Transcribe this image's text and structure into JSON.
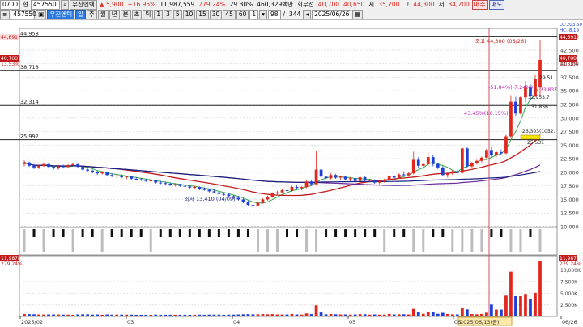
{
  "toolbar": {
    "screen_no": "0700",
    "mode": "현",
    "code": "457550",
    "name": "우진엔텍",
    "price_change": "▲ 5,900",
    "change_pct": "+16.95%",
    "volume": "11,987,559",
    "vol_ratio": "279.24%",
    "trade_share": "29.30%",
    "trade_amount": "460,329백만",
    "prev_label": "회우선",
    "price": "40,700",
    "open_val": "40,650",
    "open_label": "시",
    "open2": "35,700",
    "high_label": "고",
    "high_val": "44,300",
    "low_label": "저",
    "low_val": "34,200",
    "sell_btn": "매수",
    "buy_btn": "매도",
    "periods": [
      "주",
      "월",
      "년",
      "분",
      "초",
      "틱"
    ],
    "minutes": [
      "1",
      "3",
      "5",
      "10",
      "15",
      "30",
      "45",
      "60"
    ],
    "count_a": "1",
    "count_b": "98",
    "count_c": "344",
    "date": "2025/06/26"
  },
  "axis": {
    "price_ticks": [
      "45,000",
      "42,500",
      "40,000",
      "37,500",
      "35,000",
      "32,500",
      "30,000",
      "27,500",
      "25,000",
      "22,500",
      "20,000",
      "17,500",
      "15,000",
      "12,500",
      "10,000"
    ],
    "osc_ticks": [],
    "vol_ticks": [
      "10,000K",
      "7,500K",
      "5,000K",
      "2,500K"
    ],
    "x_labels": [
      "2025/02",
      "03",
      "04",
      "05",
      "06",
      "06/26"
    ],
    "cursor_date": "2025/06/13(금)"
  },
  "labels": {
    "left_top": "44,691",
    "left_price": "40,700",
    "left_pct": "13.53%",
    "right_high": "44,691",
    "right_price": "40,700",
    "right_pct": "13.53%",
    "right_vol": "11,987K",
    "right_vol_pct": "279.24%",
    "lc": "LC:203.50",
    "hc": "HC:-8.19",
    "left_vol": "11,987K",
    "left_vol_pct": "279.24%"
  },
  "levels": [
    {
      "value": 44958,
      "label": "44,958"
    },
    {
      "value": 38718,
      "label": "38,718"
    },
    {
      "value": 32314,
      "label": "32,314"
    },
    {
      "value": 25992,
      "label": "25,992"
    }
  ],
  "annotations": {
    "high": "최고 44,300 (06/26)",
    "low": "최저 13,410 (04/09)",
    "fib1": "-51.84%(-7.24%)",
    "fib2": "43.45%(16.15%)",
    "v1": "33,837",
    "v2": "31,856",
    "v3": "32,953.7",
    "v4": "26,303(1052.",
    "v5": "25,531",
    "v6": "29.51"
  },
  "colors": {
    "up": "#e0261d",
    "down": "#1f3fd6",
    "ma5": "#2fa84f",
    "ma20": "#c21b1b",
    "ma60": "#6a2a9a",
    "ma120": "#1a237e",
    "cursor": "#d63a5a"
  },
  "chart_data": {
    "type": "candlestick",
    "ylim": [
      10000,
      46500
    ],
    "x_start": "2025/02",
    "candles": [
      [
        21500,
        22200,
        21100,
        21800
      ],
      [
        21800,
        22000,
        21000,
        21200
      ],
      [
        21200,
        21500,
        20600,
        20900
      ],
      [
        20900,
        21400,
        20600,
        21200
      ],
      [
        21200,
        21800,
        21000,
        21500
      ],
      [
        21500,
        21600,
        20800,
        21000
      ],
      [
        21000,
        21300,
        20500,
        20700
      ],
      [
        20700,
        21300,
        20500,
        21100
      ],
      [
        21100,
        21400,
        20700,
        21000
      ],
      [
        21000,
        21500,
        20800,
        21300
      ],
      [
        21300,
        21700,
        21100,
        21500
      ],
      [
        21500,
        21600,
        20800,
        21000
      ],
      [
        21000,
        21200,
        20300,
        20500
      ],
      [
        20500,
        20900,
        20000,
        20300
      ],
      [
        20300,
        20500,
        19800,
        20000
      ],
      [
        20000,
        20300,
        19500,
        19800
      ],
      [
        19800,
        20200,
        19600,
        20000
      ],
      [
        20000,
        20100,
        19300,
        19500
      ],
      [
        19500,
        19800,
        19100,
        19300
      ],
      [
        19300,
        19700,
        19000,
        19400
      ],
      [
        19400,
        19600,
        18900,
        19100
      ],
      [
        19100,
        19400,
        18700,
        19200
      ],
      [
        19200,
        19300,
        18600,
        18800
      ],
      [
        18800,
        19100,
        18500,
        18700
      ],
      [
        18700,
        19000,
        18400,
        18600
      ],
      [
        18600,
        18800,
        18200,
        18400
      ],
      [
        18400,
        18700,
        18100,
        18500
      ],
      [
        18500,
        18600,
        17900,
        18100
      ],
      [
        18100,
        18400,
        17800,
        18000
      ],
      [
        18000,
        18300,
        17700,
        17900
      ],
      [
        17900,
        18100,
        17500,
        17700
      ],
      [
        17700,
        18000,
        17400,
        17800
      ],
      [
        17800,
        17900,
        17300,
        17500
      ],
      [
        17500,
        17800,
        17200,
        17400
      ],
      [
        17400,
        17600,
        17000,
        17200
      ],
      [
        17200,
        17500,
        16900,
        17300
      ],
      [
        17300,
        17400,
        16700,
        16900
      ],
      [
        16900,
        17200,
        16600,
        16800
      ],
      [
        16800,
        17000,
        16300,
        16500
      ],
      [
        16500,
        16800,
        16100,
        16300
      ],
      [
        16300,
        16500,
        15800,
        16000
      ],
      [
        16000,
        16300,
        15700,
        15900
      ],
      [
        15900,
        16100,
        15400,
        15600
      ],
      [
        15600,
        15800,
        15100,
        15300
      ],
      [
        15300,
        15600,
        14800,
        15000
      ],
      [
        15000,
        15200,
        14300,
        14500
      ],
      [
        14500,
        14800,
        13800,
        14000
      ],
      [
        14000,
        14300,
        13410,
        13900
      ],
      [
        13900,
        14600,
        13700,
        14400
      ],
      [
        14400,
        15200,
        14200,
        15000
      ],
      [
        15000,
        15700,
        14800,
        15500
      ],
      [
        15500,
        16300,
        15300,
        16100
      ],
      [
        16100,
        16600,
        15800,
        16300
      ],
      [
        16300,
        16900,
        16100,
        16700
      ],
      [
        16700,
        17200,
        16400,
        16600
      ],
      [
        16600,
        17500,
        16400,
        17300
      ],
      [
        17300,
        17700,
        16900,
        17100
      ],
      [
        17100,
        17400,
        16700,
        17300
      ],
      [
        17300,
        18500,
        17100,
        18300
      ],
      [
        18300,
        18600,
        17600,
        17800
      ],
      [
        17800,
        24000,
        17600,
        20500
      ],
      [
        20500,
        20800,
        18800,
        19200
      ],
      [
        19200,
        19500,
        18600,
        18900
      ],
      [
        18900,
        19800,
        18700,
        19500
      ],
      [
        19500,
        19700,
        18800,
        19000
      ],
      [
        19000,
        19400,
        18600,
        19200
      ],
      [
        19200,
        19300,
        18500,
        18700
      ],
      [
        18700,
        19100,
        18400,
        18900
      ],
      [
        18900,
        19000,
        18200,
        18400
      ],
      [
        18400,
        19300,
        18300,
        19100
      ],
      [
        19100,
        19200,
        18300,
        18500
      ],
      [
        18500,
        18800,
        18100,
        18600
      ],
      [
        18600,
        18700,
        17900,
        18100
      ],
      [
        18100,
        18500,
        17800,
        18300
      ],
      [
        18300,
        18800,
        18100,
        18600
      ],
      [
        18600,
        19500,
        18400,
        19300
      ],
      [
        19300,
        19600,
        18800,
        19000
      ],
      [
        19000,
        19800,
        18900,
        19600
      ],
      [
        19600,
        20200,
        19300,
        19500
      ],
      [
        19500,
        20000,
        19200,
        19800
      ],
      [
        19800,
        23800,
        19600,
        22300
      ],
      [
        22300,
        22800,
        20700,
        21200
      ],
      [
        21200,
        21700,
        20500,
        21500
      ],
      [
        21500,
        23700,
        21200,
        22800
      ],
      [
        22800,
        23200,
        21100,
        21500
      ],
      [
        21500,
        21800,
        20600,
        20900
      ],
      [
        20900,
        21100,
        19300,
        19500
      ],
      [
        19500,
        20100,
        19000,
        19800
      ],
      [
        19800,
        20400,
        19500,
        20200
      ],
      [
        20200,
        20500,
        19700,
        19900
      ],
      [
        19900,
        24600,
        19700,
        24400
      ],
      [
        24400,
        24700,
        20800,
        21100
      ],
      [
        21100,
        21900,
        20900,
        21700
      ],
      [
        21700,
        22300,
        21400,
        22100
      ],
      [
        22100,
        22900,
        21800,
        22700
      ],
      [
        22700,
        24300,
        22400,
        24100
      ],
      [
        24100,
        24800,
        22800,
        23100
      ],
      [
        23100,
        23900,
        22800,
        23700
      ],
      [
        23700,
        24200,
        23100,
        23500
      ],
      [
        23500,
        26900,
        23300,
        26600
      ],
      [
        26600,
        34200,
        26300,
        33000
      ],
      [
        33000,
        33900,
        30400,
        30800
      ],
      [
        30800,
        34100,
        30600,
        33800
      ],
      [
        33800,
        36800,
        32900,
        35600
      ],
      [
        35600,
        36200,
        33200,
        34000
      ],
      [
        34000,
        37900,
        33800,
        37200
      ],
      [
        35700,
        44300,
        34200,
        40700
      ]
    ]
  }
}
